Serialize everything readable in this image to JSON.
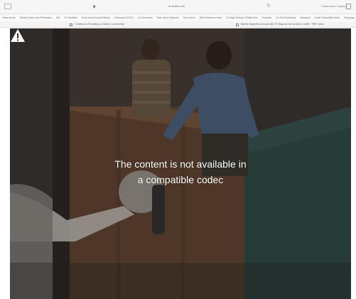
{
  "browser": {
    "url": "● reddit.com",
    "right_label": "Continuous Looped",
    "bookmarks": [
      "Jesse Dress",
      "Dietary Carb Code Reminders",
      "Mel",
      "For Buddies",
      "Good about Sound Effects",
      "Sherwood at 2014",
      "for Chromium",
      "New Voice Sessions",
      "Time Home",
      "Web Sessions Home",
      "Go High School Of Balls Rice",
      "Products",
      "Go Tick Monitoring",
      "Research",
      "Code Flowerfields Dark",
      "Shopping"
    ],
    "tab_left_label": "Continuous Shooting a Chicken Community",
    "tab_right_label": "Barbie Magnetic Arousal with 75 Bags as low as 4kb in width · RBE Video"
  },
  "video": {
    "error_line_1": "The content is not available in",
    "error_line_2": "a compatible codec",
    "icon": "warning-triangle-icon"
  }
}
